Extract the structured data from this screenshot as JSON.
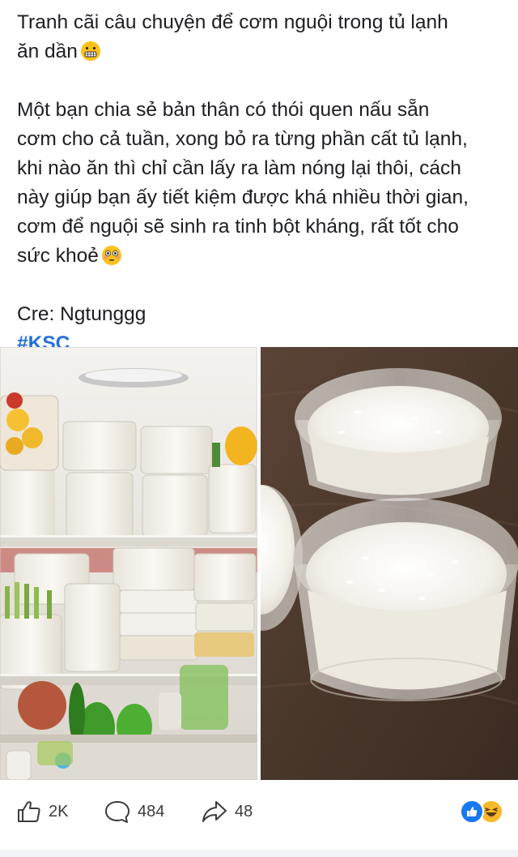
{
  "post": {
    "line1": "Tranh cãi câu chuyện để cơm nguội trong tủ lạnh",
    "line2": "ăn dần",
    "line2_emoji": "grimacing-face-emoji",
    "body_lines": [
      "Một bạn chia sẻ bản thân có thói quen nấu sẵn",
      "cơm cho cả tuần, xong bỏ ra từng phần cất tủ lạnh,",
      "khi nào ăn thì chỉ cần lấy ra làm nóng lại thôi, cách",
      "này giúp bạn ấy tiết kiệm được khá nhiều thời gian,",
      "cơm để nguội sẽ sinh ra tinh bột kháng, rất tốt cho",
      "sức khoẻ"
    ],
    "body_end_emoji": "flushed-face-emoji",
    "credit": "Cre: Ngtunggg",
    "hashtag": "#KSC"
  },
  "photos": {
    "left": "fridge-with-rice-containers",
    "right": "bowls-of-white-rice"
  },
  "actions": {
    "like_count": "2K",
    "comment_count": "484",
    "share_count": "48",
    "like_icon": "thumbs-up-icon",
    "comment_icon": "comment-icon",
    "share_icon": "share-icon"
  },
  "reactions": {
    "items": [
      "like-reaction-icon",
      "haha-reaction-icon"
    ],
    "like_color": "#1877f2",
    "haha_color": "#f7b928"
  },
  "colors": {
    "text": "#1c1e21",
    "hashtag": "#216fdb",
    "muted": "#3a3b3c"
  }
}
